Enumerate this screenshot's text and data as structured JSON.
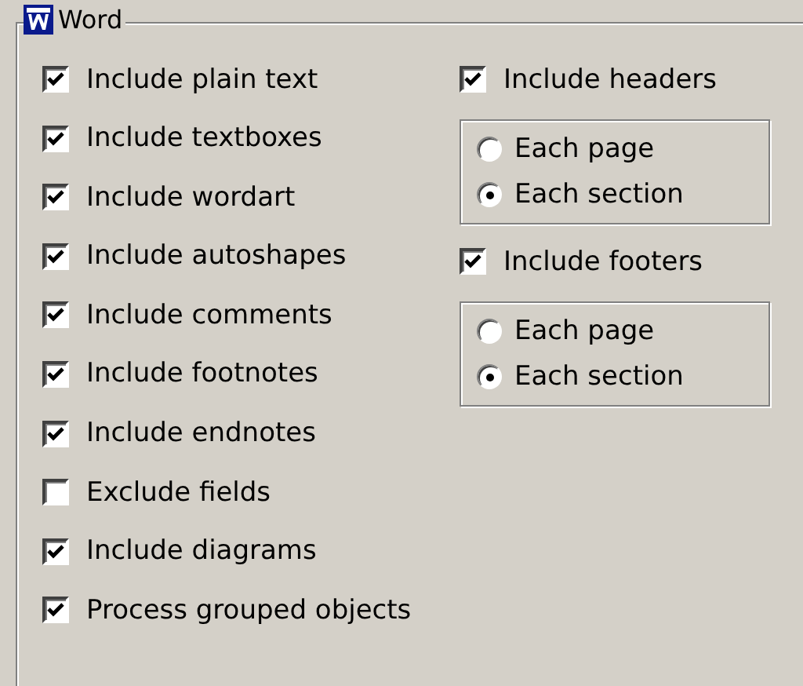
{
  "group": {
    "title": "Word"
  },
  "left_options": [
    {
      "label": "Include plain text",
      "checked": true
    },
    {
      "label": "Include textboxes",
      "checked": true
    },
    {
      "label": "Include wordart",
      "checked": true
    },
    {
      "label": "Include autoshapes",
      "checked": true
    },
    {
      "label": "Include comments",
      "checked": true
    },
    {
      "label": "Include footnotes",
      "checked": true
    },
    {
      "label": "Include endnotes",
      "checked": true
    },
    {
      "label": "Exclude fields",
      "checked": false
    },
    {
      "label": "Include diagrams",
      "checked": true
    },
    {
      "label": "Process grouped objects",
      "checked": true
    }
  ],
  "right_sections": [
    {
      "label": "Include headers",
      "checked": true,
      "radios": [
        {
          "label": "Each page",
          "selected": false
        },
        {
          "label": "Each section",
          "selected": true
        }
      ]
    },
    {
      "label": "Include footers",
      "checked": true,
      "radios": [
        {
          "label": "Each page",
          "selected": false
        },
        {
          "label": "Each section",
          "selected": true
        }
      ]
    }
  ]
}
